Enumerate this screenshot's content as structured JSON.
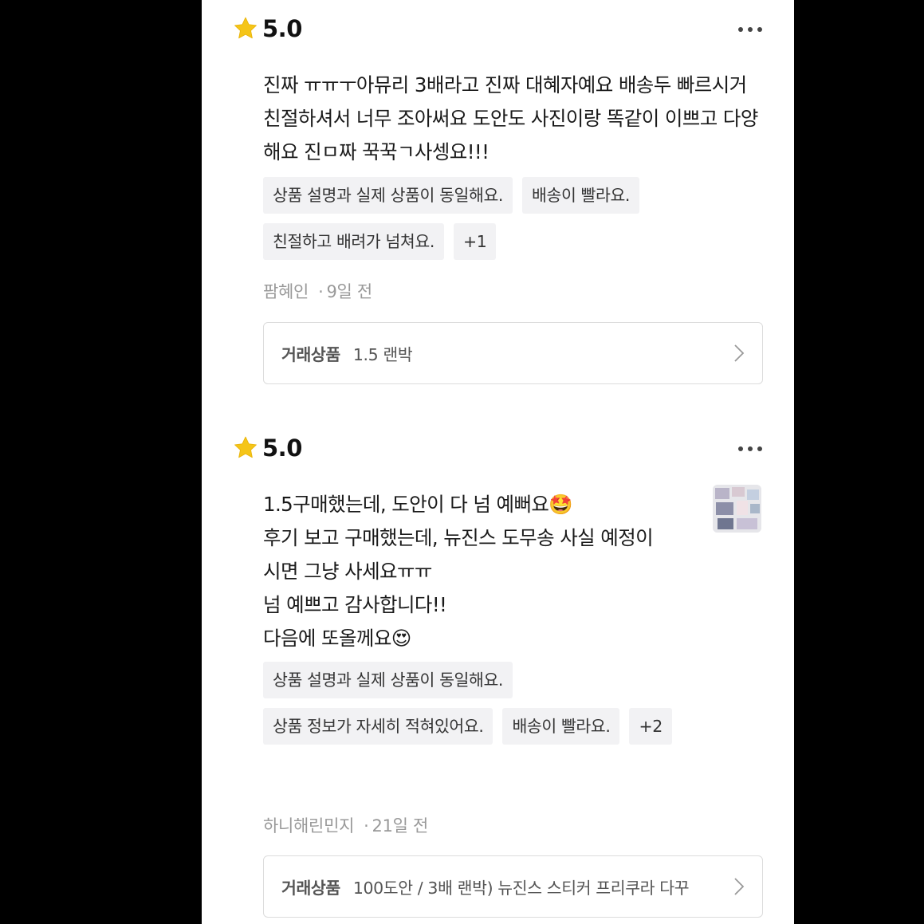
{
  "colors": {
    "star": "#f5c518",
    "tag_bg": "#f2f2f4",
    "meta_text": "#999999",
    "border": "#dcdcdc"
  },
  "reviews": [
    {
      "rating": "5.0",
      "text": "진짜 ㅠㅠㅜ아뮤리 3배라고 진짜 대혜자예요 배송두 빠르시거 친절하셔서 너무 조아써요 도안도 사진이랑 똑같이 이쁘고 다양해요 진ㅁ짜 꾹꾹ㄱ사셍요!!!",
      "tags": [
        "상품 설명과 실제 상품이 동일해요.",
        "배송이 빨라요.",
        "친절하고 배려가 넘쳐요.",
        "+1"
      ],
      "author": "팜혜인",
      "time": "9일 전",
      "product_label": "거래상품",
      "product_name": "1.5 랜박"
    },
    {
      "rating": "5.0",
      "text_lines": [
        "1.5구매했는데, 도안이 다 넘 예뻐요🤩",
        "후기 보고 구매했는데, 뉴진스 도무송 사실 예정이",
        "시면 그냥 사세요ㅠㅠ",
        "넘 예쁘고 감사합니다!!",
        "다음에 또올께요😍"
      ],
      "tags": [
        "상품 설명과 실제 상품이 동일해요.",
        "상품 정보가 자세히 적혀있어요.",
        "배송이 빨라요.",
        "+2"
      ],
      "author": "하니해린민지",
      "time": "21일 전",
      "product_label": "거래상품",
      "product_name": "100도안 / 3배 랜박) 뉴진스 스티커 프리쿠라 다꾸"
    }
  ]
}
